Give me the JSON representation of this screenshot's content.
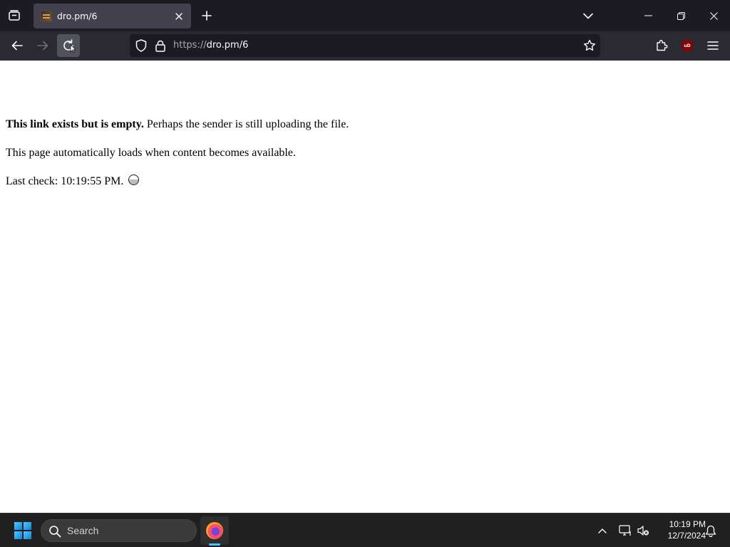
{
  "browser": {
    "tab": {
      "title": "dro.pm/6",
      "favicon": "dropm-favicon"
    },
    "url": {
      "scheme": "https://",
      "rest": "dro.pm/6"
    },
    "icons": {
      "list_all_tabs": "tab-list-icon",
      "close_tab": "close-icon",
      "new_tab": "plus-icon",
      "tabs_menu": "chevron-down-icon",
      "back": "arrow-left-icon",
      "forward": "arrow-right-icon",
      "reload": "reload-icon",
      "tracking_protection": "shield-icon",
      "site_security": "lock-icon",
      "bookmark": "star-icon",
      "extensions": "puzzle-icon",
      "ublock": "ublock-icon",
      "app_menu": "hamburger-icon"
    },
    "ublock_badge": "uD"
  },
  "page": {
    "message_bold": "This link exists but is empty.",
    "message_rest": " Perhaps the sender is still uploading the file.",
    "autoload_text": "This page automatically loads when content becomes available.",
    "last_check_text": "Last check: 10:19:55 PM."
  },
  "taskbar": {
    "search_placeholder": "Search",
    "time": "10:19 PM",
    "date": "12/7/2024"
  },
  "colors": {
    "tabstrip": "#1c1b22",
    "navbar": "#2b2a33",
    "active_tab": "#42414d",
    "taskbar": "#202020",
    "accent": "#4cc2ff"
  }
}
